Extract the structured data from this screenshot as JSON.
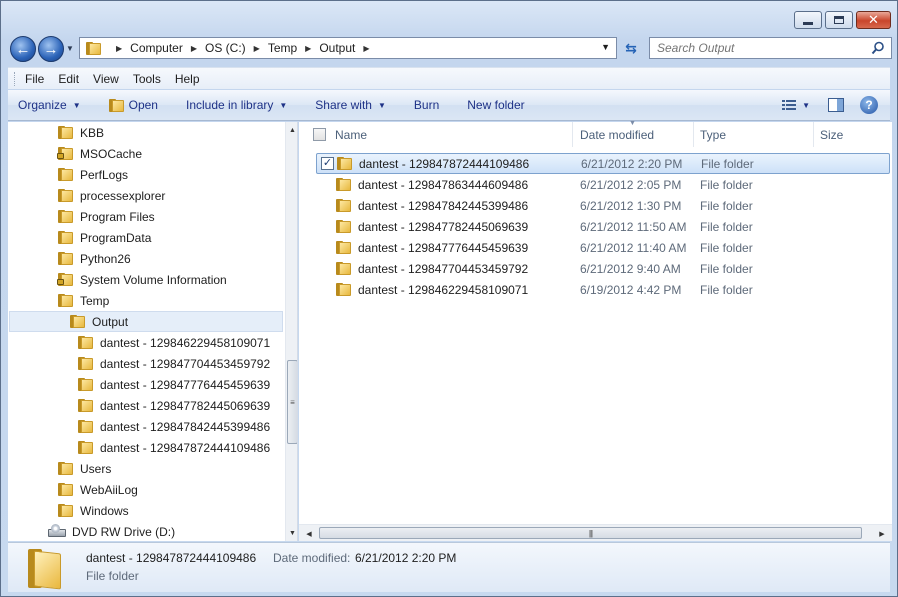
{
  "address": {
    "crumbs": [
      "Computer",
      "OS (C:)",
      "Temp",
      "Output"
    ]
  },
  "search": {
    "placeholder": "Search Output"
  },
  "menu": [
    "File",
    "Edit",
    "View",
    "Tools",
    "Help"
  ],
  "commands": {
    "organize": "Organize",
    "open": "Open",
    "include": "Include in library",
    "share": "Share with",
    "burn": "Burn",
    "new_folder": "New folder"
  },
  "tree": [
    {
      "label": "KBB",
      "indent": 1,
      "lock": false
    },
    {
      "label": "MSOCache",
      "indent": 1,
      "lock": true
    },
    {
      "label": "PerfLogs",
      "indent": 1,
      "lock": false
    },
    {
      "label": "processexplorer",
      "indent": 1,
      "lock": false
    },
    {
      "label": "Program Files",
      "indent": 1,
      "lock": false
    },
    {
      "label": "ProgramData",
      "indent": 1,
      "lock": false
    },
    {
      "label": "Python26",
      "indent": 1,
      "lock": false
    },
    {
      "label": "System Volume Information",
      "indent": 1,
      "lock": true
    },
    {
      "label": "Temp",
      "indent": 1,
      "lock": false
    },
    {
      "label": "Output",
      "indent": 2,
      "lock": false,
      "selected": true
    },
    {
      "label": "dantest - 129846229458109071",
      "indent": 3,
      "lock": false
    },
    {
      "label": "dantest - 129847704453459792",
      "indent": 3,
      "lock": false
    },
    {
      "label": "dantest - 129847776445459639",
      "indent": 3,
      "lock": false
    },
    {
      "label": "dantest - 129847782445069639",
      "indent": 3,
      "lock": false
    },
    {
      "label": "dantest - 129847842445399486",
      "indent": 3,
      "lock": false
    },
    {
      "label": "dantest - 129847872444109486",
      "indent": 3,
      "lock": false
    },
    {
      "label": "Users",
      "indent": 1,
      "lock": false
    },
    {
      "label": "WebAiiLog",
      "indent": 1,
      "lock": false
    },
    {
      "label": "Windows",
      "indent": 1,
      "lock": false
    },
    {
      "label": "DVD RW Drive (D:)",
      "indent": 0,
      "lock": false,
      "drive": true
    }
  ],
  "columns": {
    "name": "Name",
    "date": "Date modified",
    "type": "Type",
    "size": "Size"
  },
  "files": [
    {
      "name": "dantest - 129847872444109486",
      "date": "6/21/2012 2:20 PM",
      "type": "File folder",
      "selected": true
    },
    {
      "name": "dantest - 129847863444609486",
      "date": "6/21/2012 2:05 PM",
      "type": "File folder"
    },
    {
      "name": "dantest - 129847842445399486",
      "date": "6/21/2012 1:30 PM",
      "type": "File folder"
    },
    {
      "name": "dantest - 129847782445069639",
      "date": "6/21/2012 11:50 AM",
      "type": "File folder"
    },
    {
      "name": "dantest - 129847776445459639",
      "date": "6/21/2012 11:40 AM",
      "type": "File folder"
    },
    {
      "name": "dantest - 129847704453459792",
      "date": "6/21/2012 9:40 AM",
      "type": "File folder"
    },
    {
      "name": "dantest - 129846229458109071",
      "date": "6/19/2012 4:42 PM",
      "type": "File folder"
    }
  ],
  "details": {
    "name": "dantest - 129847872444109486",
    "date_label": "Date modified:",
    "date_value": "6/21/2012 2:20 PM",
    "type": "File folder"
  }
}
